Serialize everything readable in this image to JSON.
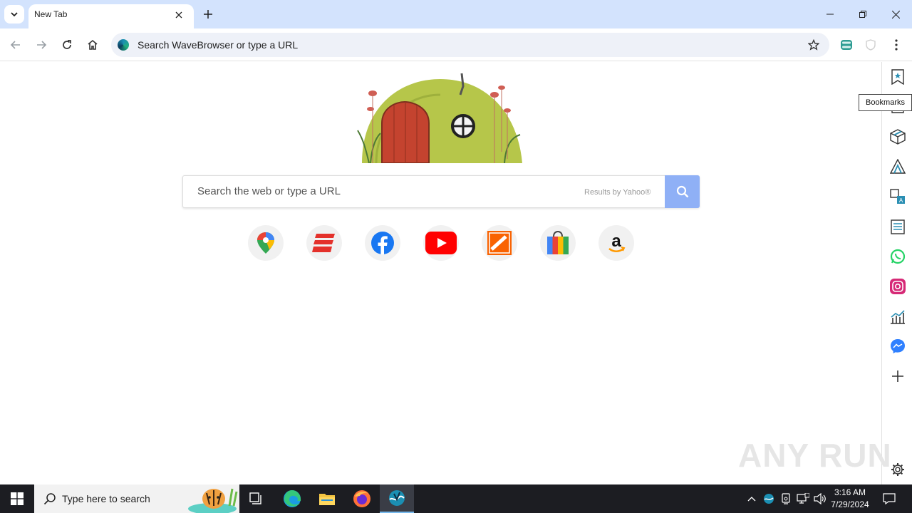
{
  "browser": {
    "tab_title": "New Tab",
    "omnibox_placeholder": "Search WaveBrowser or type a URL"
  },
  "newtab": {
    "search_placeholder": "Search the web or type a URL",
    "results_by": "Results by Yahoo®",
    "quick_links": [
      "google-maps",
      "expedia",
      "facebook",
      "youtube",
      "home-depot",
      "shopping",
      "amazon"
    ]
  },
  "sidebar": {
    "tooltip": "Bookmarks",
    "icons": [
      "bookmarks-icon",
      "reading-icon",
      "package-icon",
      "prices-icon",
      "translate-icon",
      "notes-icon",
      "whatsapp-icon",
      "instagram-icon",
      "stocks-icon",
      "messenger-icon",
      "add-icon",
      "settings-icon"
    ]
  },
  "watermark": "ANY RUN",
  "taskbar": {
    "search_placeholder": "Type here to search",
    "time": "3:16 AM",
    "date": "7/29/2024"
  },
  "colors": {
    "tabstrip": "#d3e3fd",
    "search_button": "#8fb0f6",
    "taskbar": "#1c1d22"
  }
}
